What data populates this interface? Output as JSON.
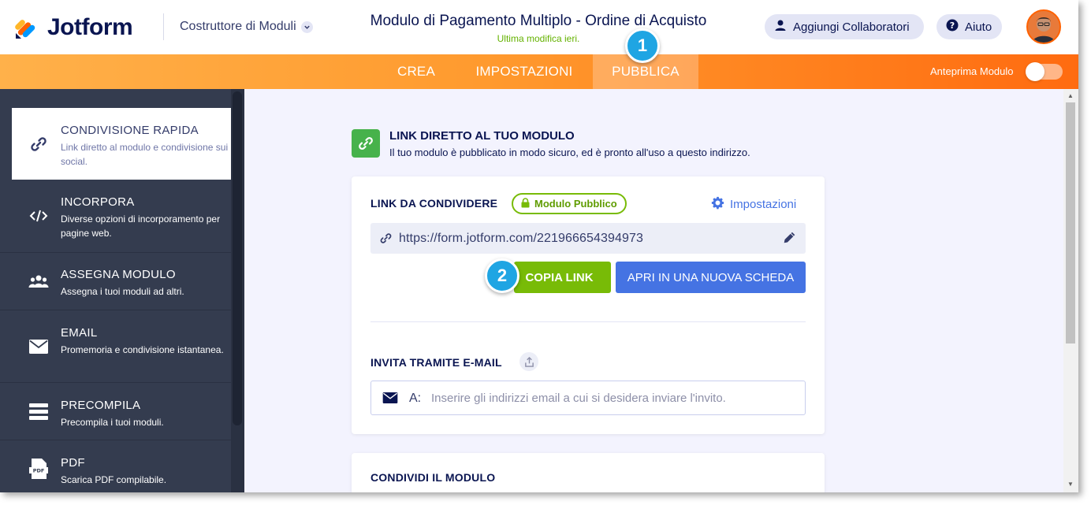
{
  "header": {
    "logo_text": "Jotform",
    "builder_label": "Costruttore di Moduli",
    "form_title": "Modulo di Pagamento Multiplo - Ordine di Acquisto",
    "last_modified": "Ultima modifica ieri.",
    "collaborators_label": "Aggiungi Collaboratori",
    "help_label": "Aiuto"
  },
  "nav": {
    "tabs": [
      {
        "label": "CREA",
        "active": false
      },
      {
        "label": "IMPOSTAZIONI",
        "active": false
      },
      {
        "label": "PUBBLICA",
        "active": true
      }
    ],
    "preview_label": "Anteprima Modulo"
  },
  "steps": [
    "1",
    "2"
  ],
  "sidebar": {
    "items": [
      {
        "title": "CONDIVISIONE RAPIDA",
        "desc": "Link diretto al modulo e condivisione sui social.",
        "icon": "link-icon",
        "active": true
      },
      {
        "title": "INCORPORA",
        "desc": "Diverse opzioni di incorporamento per pagine web.",
        "icon": "code-icon",
        "active": false
      },
      {
        "title": "ASSEGNA MODULO",
        "desc": "Assegna i tuoi moduli ad altri.",
        "icon": "users-icon",
        "active": false
      },
      {
        "title": "EMAIL",
        "desc": "Promemoria e condivisione istantanea.",
        "icon": "mail-icon",
        "active": false
      },
      {
        "title": "PRECOMPILA",
        "desc": "Precompila i tuoi moduli.",
        "icon": "list-icon",
        "active": false
      },
      {
        "title": "PDF",
        "desc": "Scarica PDF compilabile.",
        "icon": "pdf-icon",
        "active": false
      }
    ]
  },
  "main": {
    "section_title": "LINK DIRETTO AL TUO MODULO",
    "section_desc": "Il tuo modulo è pubblicato in modo sicuro, ed è pronto all'uso a questo indirizzo.",
    "share_label": "LINK DA CONDIVIDERE",
    "public_badge": "Modulo Pubblico",
    "settings_label": "Impostazioni",
    "url": "https://form.jotform.com/221966654394973",
    "copy_label": "COPIA LINK",
    "open_label": "APRI IN UNA NUOVA SCHEDA",
    "invite_label": "INVITA TRAMITE E-MAIL",
    "email_to_label": "A:",
    "email_placeholder": "Inserire gli indirizzi email a cui si desidera inviare l'invito.",
    "share_form_label": "CONDIVIDI IL MODULO"
  },
  "colors": {
    "accent_orange": "#ff6100",
    "green": "#78bb07",
    "blue": "#4573e3",
    "step_blue": "#1fa5e3",
    "sidebar_bg": "#343c4f"
  }
}
